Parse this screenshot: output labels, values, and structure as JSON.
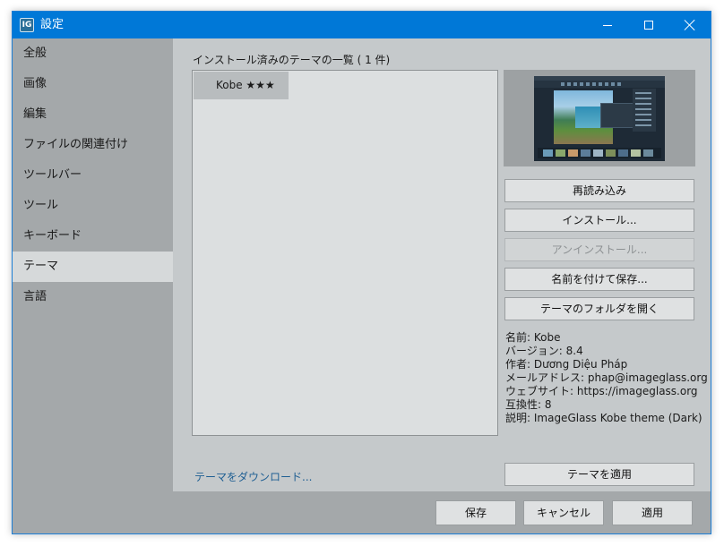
{
  "window": {
    "title": "設定",
    "app_icon_text": "IG",
    "controls": [
      "minimize-icon",
      "maximize-icon",
      "close-icon"
    ],
    "accent_color": "#0078d7"
  },
  "sidebar": {
    "items": [
      {
        "label": "全般"
      },
      {
        "label": "画像"
      },
      {
        "label": "編集"
      },
      {
        "label": "ファイルの関連付け"
      },
      {
        "label": "ツールバー"
      },
      {
        "label": "ツール"
      },
      {
        "label": "キーボード"
      },
      {
        "label": "テーマ",
        "active": true
      },
      {
        "label": "言語"
      }
    ]
  },
  "themes": {
    "heading": "インストール済みのテーマの一覧 ( 1 件)",
    "list": [
      {
        "label": "Kobe ★★★",
        "selected": true
      }
    ]
  },
  "actions": {
    "reload": "再読み込み",
    "install": "インストール...",
    "uninstall": "アンインストール...",
    "save_as": "名前を付けて保存...",
    "open_folder": "テーマのフォルダを開く",
    "apply_theme": "テーマを適用"
  },
  "info": {
    "name": "名前: Kobe",
    "version": "バージョン: 8.4",
    "author": "作者: Dương Diệu Pháp",
    "email": "メールアドレス: phap@imageglass.org",
    "website": "ウェブサイト: https://imageglass.org",
    "compatibility": "互換性: 8",
    "description": "説明: ImageGlass Kobe theme (Dark)"
  },
  "download_link": "テーマをダウンロード...",
  "footer": {
    "save": "保存",
    "cancel": "キャンセル",
    "apply": "適用"
  }
}
